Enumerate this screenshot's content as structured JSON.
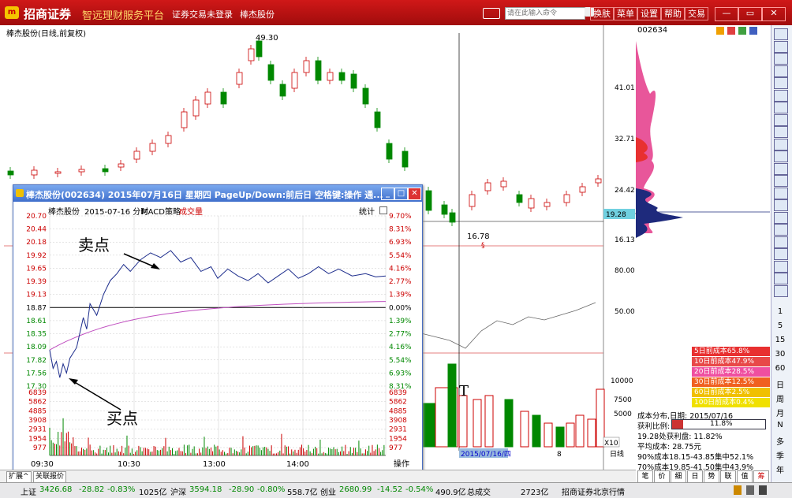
{
  "titlebar": {
    "brand": "招商证券",
    "slogan": "智远理财服务平台",
    "login_status": "证券交易未登录",
    "stock_name": "棒杰股份",
    "cmd_placeholder": "请在此输入命令",
    "menu": [
      "换肤",
      "菜单",
      "设置",
      "帮助",
      "交易"
    ],
    "window_buttons": [
      "—",
      "▭",
      "✕"
    ]
  },
  "kline": {
    "title": "棒杰股份(日线,前复权)",
    "high_label": "49.30",
    "low_label": "16.78",
    "axis_labels": [
      "41.01",
      "32.71",
      "24.42",
      "16.13"
    ],
    "current_price": "19.28",
    "indicator_labels": [
      "80.00",
      "50.00"
    ],
    "volume_labels": [
      "10000",
      "7500",
      "5000"
    ],
    "date_cursor": "2015/07/16/四",
    "cursor_marker": "8",
    "x10": "X10",
    "period_label": "日线",
    "t_annotation": "T"
  },
  "popup": {
    "title": "棒杰股份(002634)  2015年07月16日 星期四  PageUp/Down:前后日  空格键:操作  通...",
    "header": [
      "棒杰股份",
      "2015-07-16 分时",
      "MACD策略",
      "成交量"
    ],
    "stat_label": "统计",
    "price_labels": [
      "20.70",
      "20.44",
      "20.18",
      "19.92",
      "19.65",
      "19.39",
      "19.13",
      "18.87",
      "18.61",
      "18.35",
      "18.09",
      "17.82",
      "17.56",
      "17.30"
    ],
    "pct_labels": [
      "9.70%",
      "8.31%",
      "6.93%",
      "5.54%",
      "4.16%",
      "2.77%",
      "1.39%",
      "0.00%",
      "1.39%",
      "2.77%",
      "4.16%",
      "5.54%",
      "6.93%",
      "8.31%"
    ],
    "volume_labels": [
      "6839",
      "5862",
      "4885",
      "3908",
      "2931",
      "1954",
      "977"
    ],
    "time_labels": [
      "09:30",
      "10:30",
      "13:00",
      "14:00"
    ],
    "operate_label": "操作",
    "sell_label": "卖点",
    "buy_label": "买点",
    "colors": {
      "up": "#cc0000",
      "down": "#008800",
      "price_line": "#1c2c8c",
      "avg_line": "#c050c0"
    }
  },
  "distribution": {
    "code": "002634",
    "legend": [
      {
        "label": "5日前成本65.8%",
        "color": "#e83030"
      },
      {
        "label": "10日前成本47.9%",
        "color": "#e84848"
      },
      {
        "label": "20日前成本28.5%",
        "color": "#ef4fa0"
      },
      {
        "label": "30日前成本12.5%",
        "color": "#f06020"
      },
      {
        "label": "60日前成本2.5%",
        "color": "#f0c000"
      },
      {
        "label": "100日前成本0.4%",
        "color": "#f0e000"
      }
    ],
    "info": {
      "cost_date": "成本分布,日期: 2015/07/16",
      "profit_ratio_label": "获利比例:",
      "profit_ratio": "11.8%",
      "profit_at": "19.28处获利盘: 11.82%",
      "avg_cost": "平均成本: 28.75元",
      "range90": "90%成本18.15-43.85集中52.1%",
      "range70": "70%成本19.85-41.50集中43.9%"
    },
    "sub_tabs": [
      "笔",
      "价",
      "细",
      "日",
      "势",
      "联",
      "值",
      "筹"
    ]
  },
  "toolbar_right": [
    "1",
    "5",
    "15",
    "30",
    "60",
    "日",
    "周",
    "月",
    "N",
    "多",
    "季",
    "年"
  ],
  "tabs": [
    "扩展^",
    "关联报价"
  ],
  "bottom": {
    "sh_label": "上证",
    "sh_value": "3426.68",
    "sh_change": "-28.82",
    "sh_pct": "-0.83%",
    "sh_amount": "1025亿",
    "hs_label": "沪深",
    "hs_value": "3594.18",
    "hs_change": "-28.90",
    "hs_pct": "-0.80%",
    "hs_amount": "558.7亿",
    "cy_label": "创业",
    "cy_value": "2680.99",
    "cy_change": "-14.52",
    "cy_pct": "-0.54%",
    "cy_amount": "490.9亿",
    "total_label": "总成交",
    "total_value": "2723亿",
    "broker": "招商证券北京行情"
  }
}
